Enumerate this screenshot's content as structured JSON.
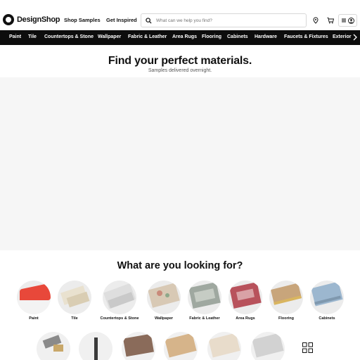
{
  "header": {
    "logo": "DesignShop",
    "nav": [
      "Shop Samples",
      "Get Inspired"
    ],
    "search_placeholder": "What can we help you find?",
    "icons": [
      "location-pin-icon",
      "cart-icon",
      "menu-icon",
      "account-icon"
    ]
  },
  "categories": [
    "Paint",
    "Tile",
    "Countertops & Stone",
    "Wallpaper",
    "Fabric & Leather",
    "Area Rugs",
    "Flooring",
    "Cabinets",
    "Hardware",
    "Faucets & Fixtures",
    "Exterior"
  ],
  "hero": {
    "title": "Find your perfect materials.",
    "subtitle": "Samples delivered overnight."
  },
  "section": {
    "title": "What are you looking for?",
    "items": [
      "Paint",
      "Tile",
      "Countertops & Stone",
      "Wallpaper",
      "Fabric & Leather",
      "Area Rugs",
      "Flooring",
      "Cabinets"
    ]
  },
  "colors": {
    "category_bar": "#0d0d0d",
    "paint": "#e8483a"
  }
}
